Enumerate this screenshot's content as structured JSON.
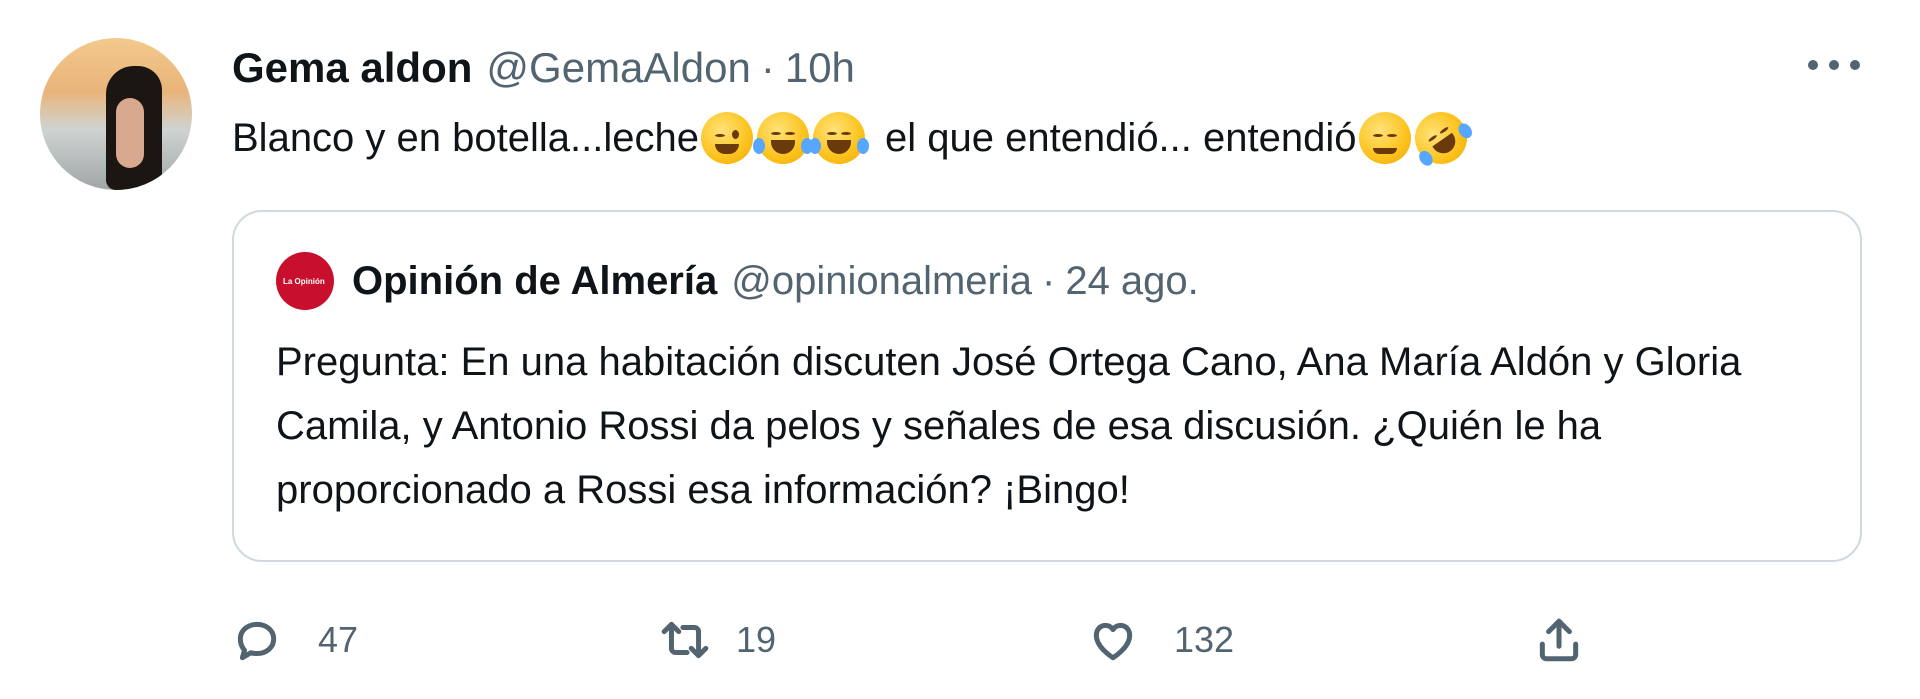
{
  "tweet": {
    "author_name": "Gema aldon",
    "author_handle": "@GemaAldon",
    "separator": "·",
    "time": "10h",
    "text_part1": "Blanco y en botella...leche",
    "text_part2": "el que entendió... entendió",
    "emojis": [
      "winking-face",
      "face-with-tears-of-joy",
      "face-with-tears-of-joy",
      "relieved-face",
      "rolling-on-floor-laughing"
    ]
  },
  "quoted": {
    "author_name": "Opinión de Almería",
    "author_handle": "@opinionalmeria",
    "separator": "·",
    "time": "24 ago.",
    "avatar_text": "La Opinión de Almería",
    "text": "Pregunta: En una habitación discuten José Ortega Cano, Ana María Aldón y Gloria Camila, y Antonio Rossi da pelos y señales de esa discusión. ¿Quién le ha proporcionado a Rossi esa información? ¡Bingo!"
  },
  "actions": {
    "replies": "47",
    "retweets": "19",
    "likes": "132"
  },
  "icons": [
    "reply-icon",
    "retweet-icon",
    "like-icon",
    "share-icon",
    "more-icon"
  ],
  "colors": {
    "text": "#0f1419",
    "secondary": "#536471",
    "border": "#cfd9de",
    "quoted_avatar": "#c8102e"
  }
}
